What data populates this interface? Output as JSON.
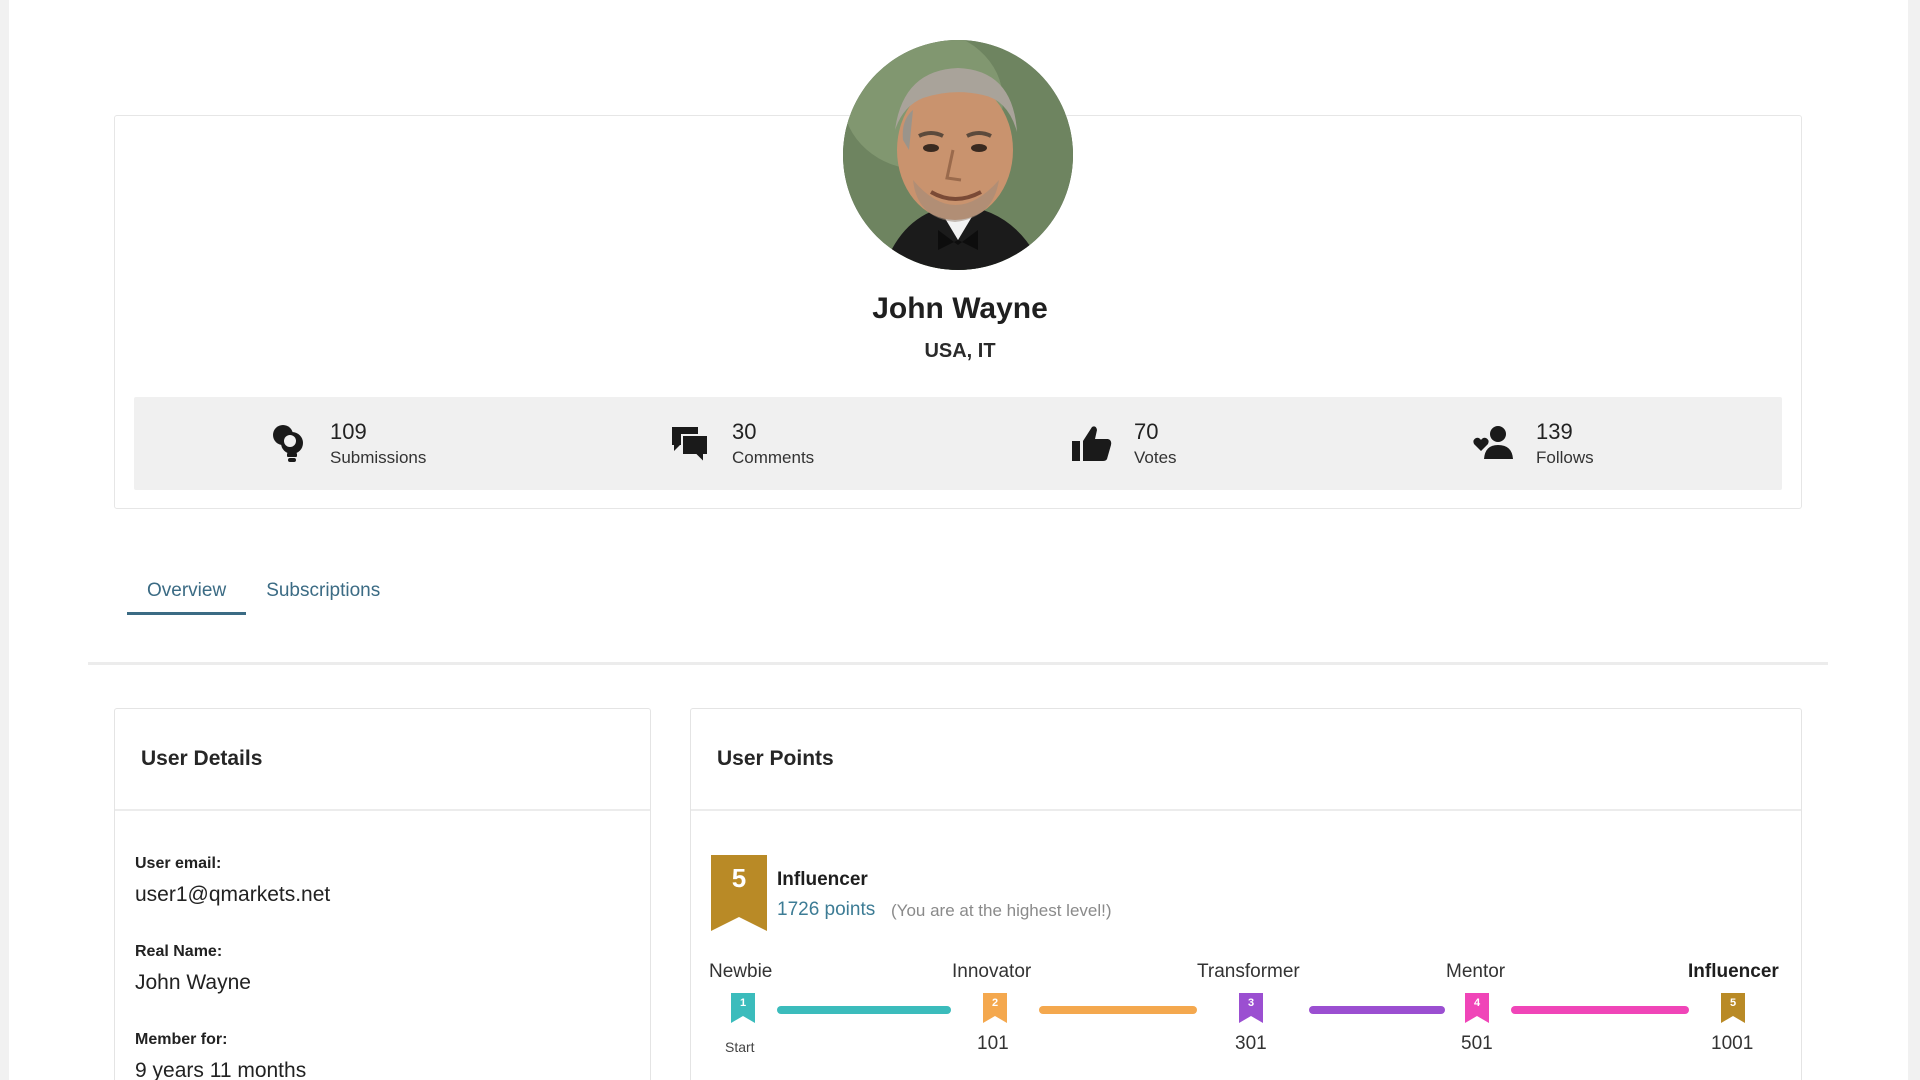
{
  "profile": {
    "name": "John Wayne",
    "location": "USA, IT",
    "stats": [
      {
        "icon": "lightbulb-icon",
        "count": "109",
        "label": "Submissions"
      },
      {
        "icon": "comments-icon",
        "count": "30",
        "label": "Comments"
      },
      {
        "icon": "thumbs-up-icon",
        "count": "70",
        "label": "Votes"
      },
      {
        "icon": "user-heart-icon",
        "count": "139",
        "label": "Follows"
      }
    ]
  },
  "tabs": [
    {
      "label": "Overview",
      "active": true
    },
    {
      "label": "Subscriptions",
      "active": false
    }
  ],
  "user_details": {
    "title": "User Details",
    "email_label": "User email:",
    "email": "user1@qmarkets.net",
    "real_name_label": "Real Name:",
    "real_name": "John Wayne",
    "member_for_label": "Member for:",
    "member_for": "9 years 11 months"
  },
  "user_points": {
    "title": "User Points",
    "level_number": "5",
    "level_name": "Influencer",
    "points": "1726 points",
    "note": "(You are at the highest level!)",
    "levels": [
      {
        "name": "Newbie",
        "number": "1",
        "threshold": "Start",
        "color": "#3bbcbc"
      },
      {
        "name": "Innovator",
        "number": "2",
        "threshold": "101",
        "color": "#f4a84e"
      },
      {
        "name": "Transformer",
        "number": "3",
        "threshold": "301",
        "color": "#9b4fd1"
      },
      {
        "name": "Mentor",
        "number": "4",
        "threshold": "501",
        "color": "#f045b8"
      },
      {
        "name": "Influencer",
        "number": "5",
        "threshold": "1001",
        "color": "#b98a26"
      }
    ]
  }
}
